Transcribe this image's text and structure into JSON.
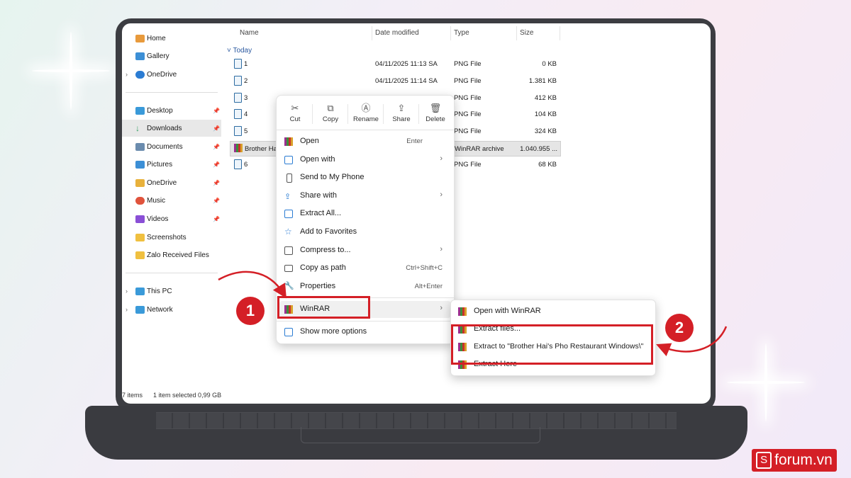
{
  "sidebar": {
    "items": [
      {
        "label": "Home",
        "icon": "home-icon",
        "color": "#e89a3c"
      },
      {
        "label": "Gallery",
        "icon": "gallery-icon",
        "color": "#3c8fd6"
      },
      {
        "label": "OneDrive",
        "icon": "cloud-icon",
        "color": "#2b7cd3"
      },
      {
        "label": "Desktop",
        "icon": "desktop-icon",
        "color": "#3a9ad9"
      },
      {
        "label": "Downloads",
        "icon": "download-icon",
        "color": "#2f9e5f"
      },
      {
        "label": "Documents",
        "icon": "document-icon",
        "color": "#6b8cae"
      },
      {
        "label": "Pictures",
        "icon": "pictures-icon",
        "color": "#3c8fd6"
      },
      {
        "label": "OneDrive",
        "icon": "cloud-icon",
        "color": "#e8b13c"
      },
      {
        "label": "Music",
        "icon": "music-icon",
        "color": "#e0533c"
      },
      {
        "label": "Videos",
        "icon": "videos-icon",
        "color": "#8a4fd6"
      },
      {
        "label": "Screenshots",
        "icon": "folder-icon",
        "color": "#f0c040"
      },
      {
        "label": "Zalo Received Files",
        "icon": "folder-icon",
        "color": "#f0c040"
      },
      {
        "label": "This PC",
        "icon": "computer-icon",
        "color": "#3a9ad9"
      },
      {
        "label": "Network",
        "icon": "network-icon",
        "color": "#3a9ad9"
      }
    ]
  },
  "columns": {
    "name": "Name",
    "date": "Date modified",
    "type": "Type",
    "size": "Size"
  },
  "group_label": "Today",
  "files": [
    {
      "name": "1",
      "date": "04/11/2025 11:13 SA",
      "type": "PNG File",
      "size": "0 KB"
    },
    {
      "name": "2",
      "date": "04/11/2025 11:14 SA",
      "type": "PNG File",
      "size": "1.381 KB"
    },
    {
      "name": "3",
      "date": "",
      "type": "PNG File",
      "size": "412 KB"
    },
    {
      "name": "4",
      "date": "",
      "type": "PNG File",
      "size": "104 KB"
    },
    {
      "name": "5",
      "date": "",
      "type": "PNG File",
      "size": "324 KB"
    },
    {
      "name": "Brother Ha",
      "date": "",
      "type": "WinRAR archive",
      "size": "1.040.955 ..."
    },
    {
      "name": "6",
      "date": "",
      "type": "PNG File",
      "size": "68 KB"
    }
  ],
  "status": {
    "items": "7 items",
    "selected": "1 item selected  0,99 GB"
  },
  "quick_actions": [
    "Cut",
    "Copy",
    "Rename",
    "Share",
    "Delete"
  ],
  "menu": {
    "open": "Open",
    "open_short": "Enter",
    "open_with": "Open with",
    "send_phone": "Send to My Phone",
    "share_with": "Share with",
    "extract_all": "Extract All...",
    "add_fav": "Add to Favorites",
    "compress": "Compress to...",
    "copy_path": "Copy as path",
    "copy_path_short": "Ctrl+Shift+C",
    "properties": "Properties",
    "properties_short": "Alt+Enter",
    "winrar": "WinRAR",
    "more": "Show more options"
  },
  "submenu": {
    "open_winrar": "Open with WinRAR",
    "extract_files": "Extract files...",
    "extract_to": "Extract to \"Brother Hai's Pho Restaurant Windows\\\"",
    "extract_here": "Extract Here"
  },
  "steps": {
    "one": "1",
    "two": "2"
  },
  "brand": {
    "letter": "S",
    "text": "forum.vn"
  },
  "colors": {
    "accent": "#d41f26",
    "rar": "#9b2f8f"
  }
}
